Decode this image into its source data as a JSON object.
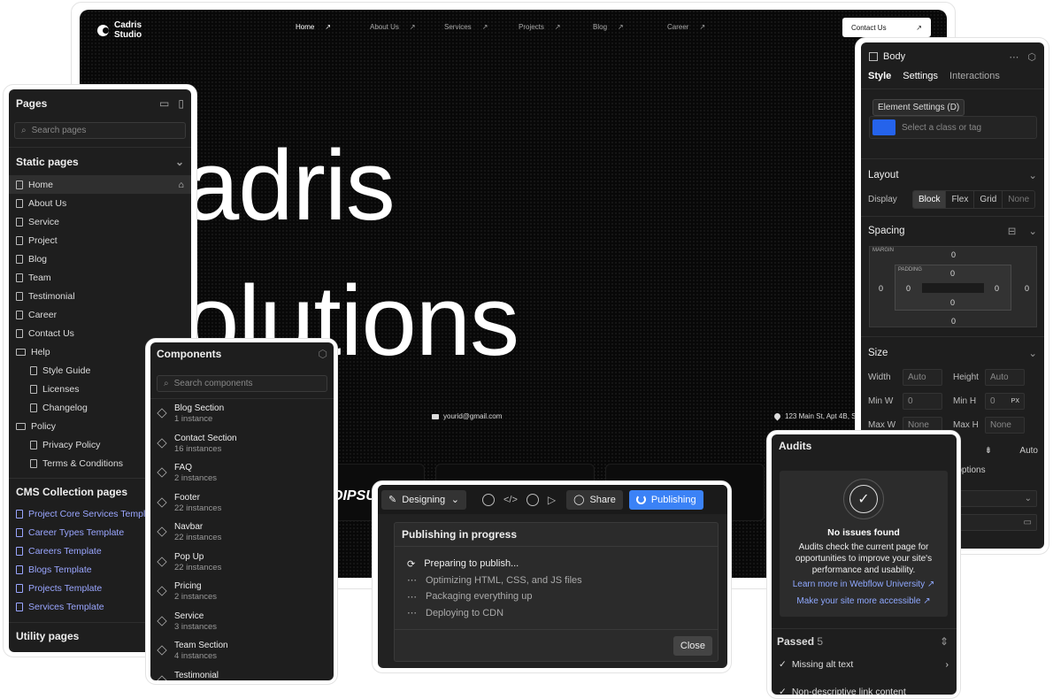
{
  "site": {
    "logo": [
      "Cadris",
      "Studio"
    ],
    "nav": [
      "Home",
      "About Us",
      "Services",
      "Projects",
      "Blog",
      "Career"
    ],
    "contact": "Contact Us",
    "hero_line1": "adris",
    "hero_line2": "olutions",
    "email": "yourid@gmail.com",
    "address": "123 Main St, Apt 4B, S",
    "strip_text": "OIPSU"
  },
  "pages": {
    "title": "Pages",
    "search_placeholder": "Search pages",
    "static_title": "Static pages",
    "static": [
      "Home",
      "About Us",
      "Service",
      "Project",
      "Blog",
      "Team",
      "Testimonial",
      "Career",
      "Contact Us"
    ],
    "help": "Help",
    "help_children": [
      "Style Guide",
      "Licenses",
      "Changelog"
    ],
    "policy": "Policy",
    "policy_children": [
      "Privacy Policy",
      "Terms & Conditions"
    ],
    "cms_title": "CMS Collection pages",
    "cms": [
      "Project Core Services Template",
      "Career Types Template",
      "Careers Template",
      "Blogs Template",
      "Projects Template",
      "Services Template"
    ],
    "utility_title": "Utility pages"
  },
  "components": {
    "title": "Components",
    "search_placeholder": "Search components",
    "items": [
      {
        "name": "Blog Section",
        "count": "1 instance"
      },
      {
        "name": "Contact Section",
        "count": "16 instances"
      },
      {
        "name": "FAQ",
        "count": "2 instances"
      },
      {
        "name": "Footer",
        "count": "22 instances"
      },
      {
        "name": "Navbar",
        "count": "22 instances"
      },
      {
        "name": "Pop Up",
        "count": "22 instances"
      },
      {
        "name": "Pricing",
        "count": "2 instances"
      },
      {
        "name": "Service",
        "count": "3 instances"
      },
      {
        "name": "Team Section",
        "count": "4 instances"
      },
      {
        "name": "Testimonial",
        "count": ""
      }
    ]
  },
  "style": {
    "element": "Body",
    "tabs": [
      "Style",
      "Settings",
      "Interactions"
    ],
    "tooltip": "Element Settings (D)",
    "selector_placeholder": "Select a class or tag",
    "layout": "Layout",
    "display_label": "Display",
    "display_opts": [
      "Block",
      "Flex",
      "Grid",
      "None"
    ],
    "spacing": "Spacing",
    "margin_label": "MARGIN",
    "padding_label": "PADDING",
    "zero": "0",
    "size": "Size",
    "width": "Width",
    "height": "Height",
    "minw": "Min W",
    "minh": "Min H",
    "maxw": "Max W",
    "maxh": "Max H",
    "auto": "Auto",
    "none": "None",
    "px": "PX",
    "options_text": "e options"
  },
  "publish": {
    "mode": "Designing",
    "share": "Share",
    "publishing": "Publishing",
    "box_title": "Publishing in progress",
    "steps": [
      "Preparing to publish...",
      "Optimizing HTML, CSS, and JS files",
      "Packaging everything up",
      "Deploying to CDN"
    ],
    "close": "Close"
  },
  "audits": {
    "title": "Audits",
    "status": "No issues found",
    "desc": "Audits check the current page for opportunities to improve your site's performance and usability.",
    "link1": "Learn more in Webflow University ↗",
    "link2": "Make your site more accessible ↗",
    "passed_label": "Passed",
    "passed_count": "5",
    "item1": "Missing alt text",
    "item2": "Non-descriptive link content"
  },
  "colors": {
    "accent": "#3b82f6",
    "link": "#8fa8ff",
    "cms": "#9aa6ff"
  }
}
